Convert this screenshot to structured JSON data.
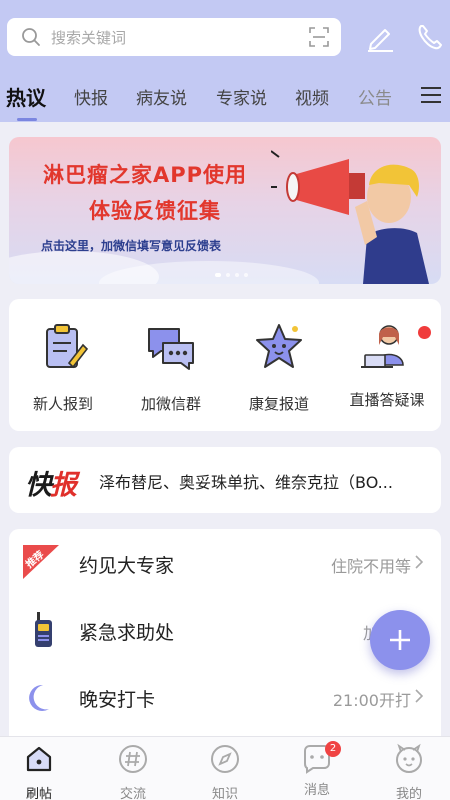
{
  "search": {
    "placeholder": "搜索关键词"
  },
  "tabs": [
    {
      "label": "热议",
      "active": true
    },
    {
      "label": "快报"
    },
    {
      "label": "病友说"
    },
    {
      "label": "专家说"
    },
    {
      "label": "视频"
    },
    {
      "label": "公告"
    }
  ],
  "banner": {
    "line1": "淋巴瘤之家APP使用",
    "line2": "体验反馈征集",
    "line3": "点击这里，加微信填写意见反馈表"
  },
  "quick": [
    {
      "label": "新人报到",
      "icon": "clipboard-icon"
    },
    {
      "label": "加微信群",
      "icon": "chat-bubbles-icon"
    },
    {
      "label": "康复报道",
      "icon": "star-icon"
    },
    {
      "label": "直播答疑课",
      "icon": "live-lecture-icon",
      "has_dot": true
    }
  ],
  "news": {
    "logo_a": "快",
    "logo_b": "报",
    "text": "泽布替尼、奥妥珠单抗、维奈克拉（BO..."
  },
  "list": [
    {
      "name": "约见大专家",
      "value": "住院不用等",
      "tag": "推荐",
      "icon": "recommend-tag-icon"
    },
    {
      "name": "紧急求助处",
      "value": "加微信",
      "icon": "walkie-talkie-icon"
    },
    {
      "name": "晚安打卡",
      "value": "21:00开打",
      "icon": "moon-icon"
    }
  ],
  "bottom_nav": [
    {
      "label": "刷帖",
      "icon": "home-icon",
      "active": true
    },
    {
      "label": "交流",
      "icon": "hashtag-icon"
    },
    {
      "label": "知识",
      "icon": "compass-icon"
    },
    {
      "label": "消息",
      "icon": "message-icon",
      "badge": "2"
    },
    {
      "label": "我的",
      "icon": "face-icon"
    }
  ],
  "colors": {
    "accent": "#8c91ec",
    "header": "#c3c9f3",
    "red": "#e2372d"
  }
}
